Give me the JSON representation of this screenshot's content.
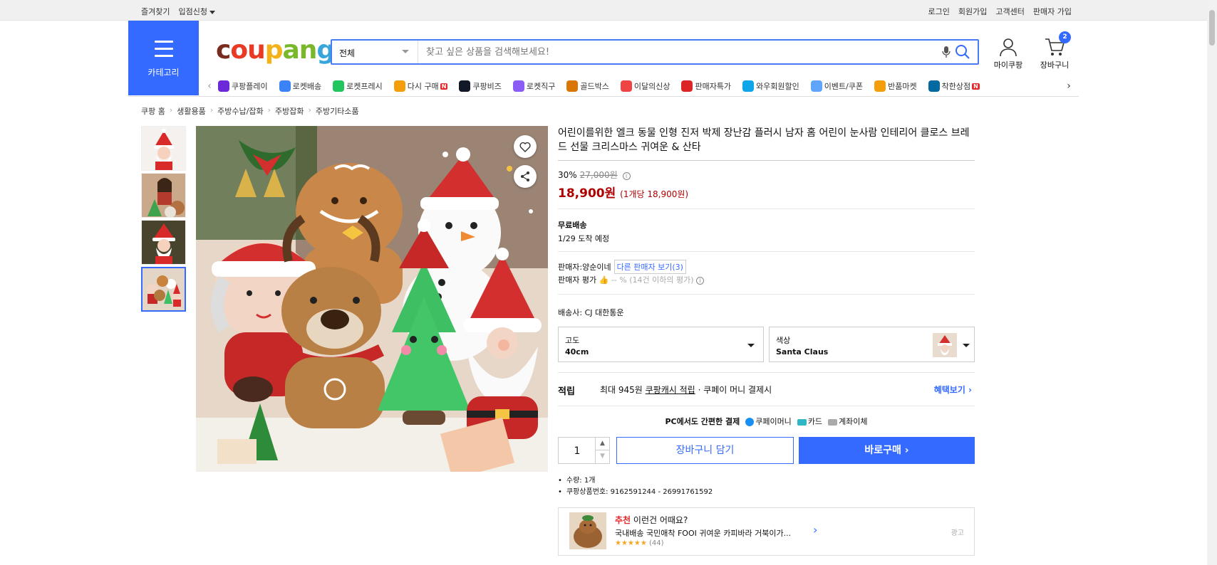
{
  "topbar": {
    "favorites": "즐겨찾기",
    "store_apply": "입점신청",
    "login": "로그인",
    "signup": "회원가입",
    "support": "고객센터",
    "seller_signup": "판매자 가입"
  },
  "category_button": {
    "label": "카테고리"
  },
  "logo": {
    "parts": [
      "c",
      "ou",
      "p",
      "an",
      "g"
    ]
  },
  "search": {
    "category": "전체",
    "placeholder": "찾고 싶은 상품을 검색해보세요!"
  },
  "header_icons": {
    "my": "마이쿠팡",
    "cart": "장바구니",
    "cart_count": "2"
  },
  "nav": {
    "items": [
      {
        "label": "쿠팡플레이",
        "color": "#6d28d9"
      },
      {
        "label": "로켓배송",
        "color": "#3b82f6"
      },
      {
        "label": "로켓프레시",
        "color": "#22c55e"
      },
      {
        "label": "다시 구매",
        "color": "#f59e0b",
        "new": "N"
      },
      {
        "label": "쿠팡비즈",
        "color": "#111827"
      },
      {
        "label": "로켓직구",
        "color": "#8b5cf6"
      },
      {
        "label": "골드박스",
        "color": "#d97706"
      },
      {
        "label": "이달의신상",
        "color": "#ef4444"
      },
      {
        "label": "판매자특가",
        "color": "#dc2626"
      },
      {
        "label": "와우회원할인",
        "color": "#0ea5e9"
      },
      {
        "label": "이벤트/쿠폰",
        "color": "#60a5fa"
      },
      {
        "label": "반품마켓",
        "color": "#f59e0b"
      },
      {
        "label": "착한상점",
        "color": "#0369a1",
        "new": "N"
      }
    ]
  },
  "breadcrumb": [
    "쿠팡 홈",
    "생활용품",
    "주방수납/잡화",
    "주방잡화",
    "주방기타소품"
  ],
  "product": {
    "title": "어린이를위한 엘크 동물 인형 진저 박제 장난감 플러시 남자 홈 어린이 눈사람 인테리어 클로스 브레드 선물 크리스마스 귀여운 & 산타",
    "discount_rate": "30%",
    "original_price": "27,000원",
    "price": "18,900원",
    "unit_price": "(1개당 18,900원)",
    "shipping_label": "무료배송",
    "arrival": "1/29 도착 예정",
    "seller_prefix": "판매자:",
    "seller_name": "양순이네",
    "other_sellers": "다른 판매자 보기(3)",
    "rating_label": "판매자 평가",
    "rating_value": "-- % (14건 이하의 평가)",
    "courier_label": "배송사:",
    "courier": "CJ 대한통운",
    "option1_label": "고도",
    "option1_value": "40cm",
    "option2_label": "색상",
    "option2_value": "Santa Claus",
    "reward_heading": "적립",
    "reward_text_pre": "최대 945원",
    "reward_link": "쿠팡캐시 적립",
    "reward_text_post": "· 쿠페이 머니 결제시",
    "reward_more": "혜택보기 ›",
    "pay_heading": "PC에서도 간편한 결제",
    "pay_methods": [
      "쿠페이머니",
      "카드",
      "계좌이체"
    ],
    "quantity": "1",
    "add_to_cart": "장바구니 담기",
    "buy_now": "바로구매 ›",
    "facts": [
      "수량: 1개",
      "쿠팡상품번호: 9162591244 - 26991761592"
    ]
  },
  "recommend": {
    "tag": "추천",
    "heading": "이런건 어때요?",
    "item": "국내배송 국민애착 FOOI 귀여운 카피바라 거북이가...",
    "stars": "★★★★★",
    "count": "(44)",
    "ad": "광고"
  },
  "colors": {
    "accent": "#346aff",
    "price": "#ae0000"
  }
}
